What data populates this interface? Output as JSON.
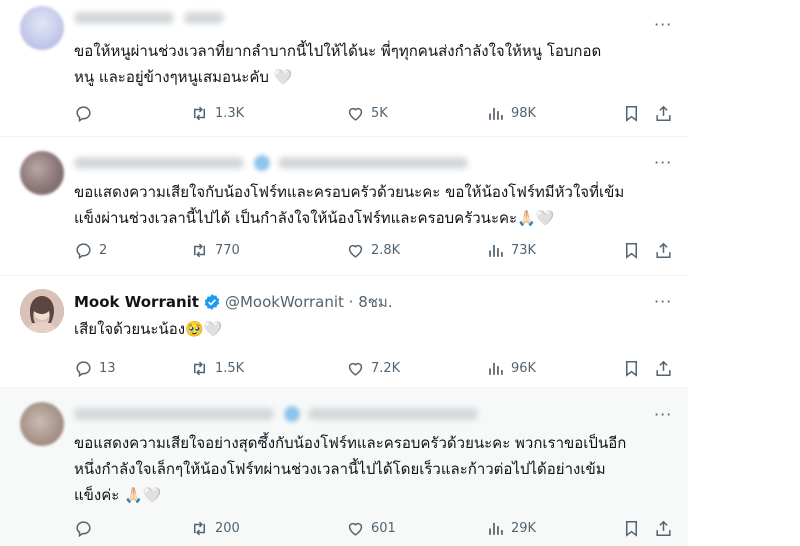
{
  "tweets": [
    {
      "text_line1": "ขอให้หนูผ่านช่วงเวลาที่ยากลำบากนี้ไปให้ได้นะ พี่ๆทุกคนส่งกำลังใจให้หนู โอบกอด",
      "text_line2": "หนู และอยู่ข้างๆหนูเสมอนะคับ 🤍",
      "reply": "",
      "retweet": "1.3K",
      "like": "5K",
      "views": "98K"
    },
    {
      "text_line1": "ขอแสดงความเสียใจกับน้องโฟร์ทและครอบครัวด้วยนะคะ ขอให้น้องโฟร์ทมีหัวใจที่เข้ม",
      "text_line2": "แข็งผ่านช่วงเวลานี้ไปได้ เป็นกำลังใจให้น้องโฟร์ทและครอบครัวนะคะ🙏🏻🤍",
      "reply": "2",
      "retweet": "770",
      "like": "2.8K",
      "views": "73K"
    },
    {
      "name": "Mook Worranit",
      "handle": "@MookWorranit · 8ชม.",
      "text_line1": "เสียใจด้วยนะน้อง🥹🤍",
      "reply": "13",
      "retweet": "1.5K",
      "like": "7.2K",
      "views": "96K"
    },
    {
      "text_line1": "ขอแสดงความเสียใจอย่างสุดซึ้งกับน้องโฟร์ทและครอบครัวด้วยนะคะ พวกเราขอเป็นอีก",
      "text_line2": "หนึ่งกำลังใจเล็กๆให้น้องโฟร์ทผ่านช่วงเวลานี้ไปได้โดยเร็วและก้าวต่อไปได้อย่างเข้ม",
      "text_line3": "แข็งค่ะ 🙏🏻🤍",
      "reply": "",
      "retweet": "200",
      "like": "601",
      "views": "29K"
    }
  ],
  "more_label": "···",
  "colors": {
    "verified": "#1d9bf0",
    "muted": "#536471",
    "text": "#0f1419",
    "shaded_bg": "#f7f9f9"
  }
}
